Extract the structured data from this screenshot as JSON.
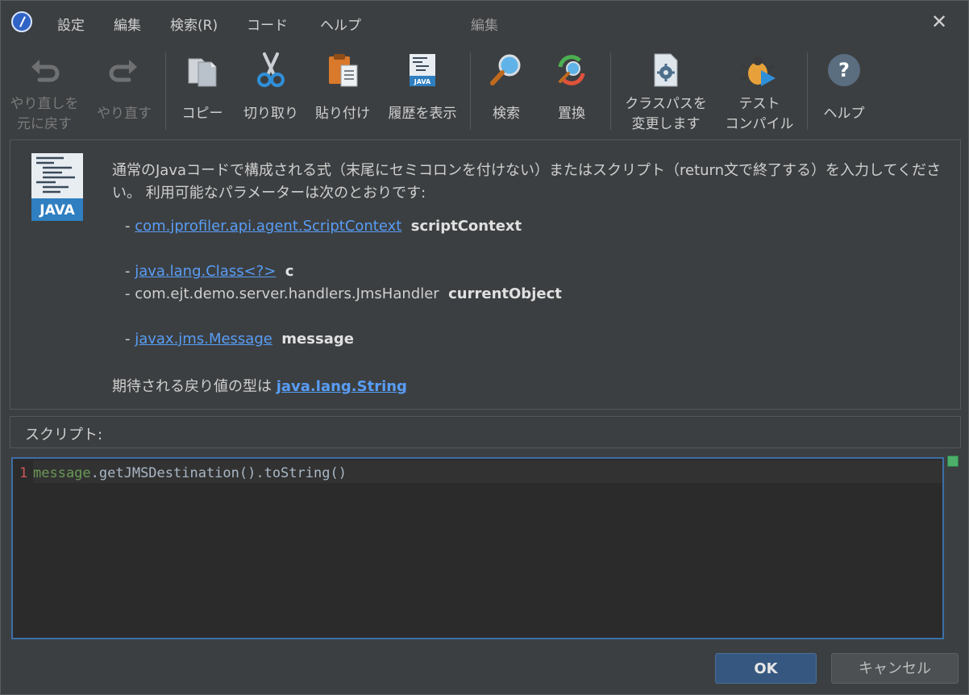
{
  "titlebar": {
    "menus": [
      "設定",
      "編集",
      "検索(R)",
      "コード",
      "ヘルプ"
    ],
    "title": "編集",
    "close_symbol": "✕"
  },
  "toolbar": {
    "undo": "やり直しを\n元に戻す",
    "redo": "やり直す",
    "copy": "コピー",
    "cut": "切り取り",
    "paste": "貼り付け",
    "history": "履歴を表示",
    "find": "検索",
    "replace": "置換",
    "classpath": "クラスパスを\n変更します",
    "test_compile": "テスト\nコンパイル",
    "help": "ヘルプ"
  },
  "info": {
    "description": "通常のJavaコードで構成される式（末尾にセミコロンを付けない）またはスクリプト（return文で終了する）を入力してください。 利用可能なパラメーターは次のとおりです:",
    "icon_text": "JAVA",
    "params": [
      {
        "prefix": "- ",
        "type": "com.jprofiler.api.agent.ScriptContext",
        "name": "scriptContext"
      },
      {
        "prefix": "- ",
        "type": "java.lang.Class<?>",
        "name": "c"
      },
      {
        "prefix": "- com.ejt.demo.server.handlers.JmsHandler",
        "type": "",
        "name": "currentObject"
      },
      {
        "prefix": "- ",
        "type": "javax.jms.Message",
        "name": "message"
      }
    ],
    "return_prefix": "期待される戻り値の型は ",
    "return_type": "java.lang.String"
  },
  "script": {
    "label": "スクリプト:",
    "line_number": "1",
    "code_var": "message",
    "code_rest": ".getJMSDestination().toString()"
  },
  "buttons": {
    "ok": "OK",
    "cancel": "キャンセル"
  },
  "colors": {
    "background": "#3c3f41",
    "editor_bg": "#2b2b2b",
    "link": "#589df6",
    "ok_button": "#365880",
    "editor_border": "#3d6fa8"
  }
}
